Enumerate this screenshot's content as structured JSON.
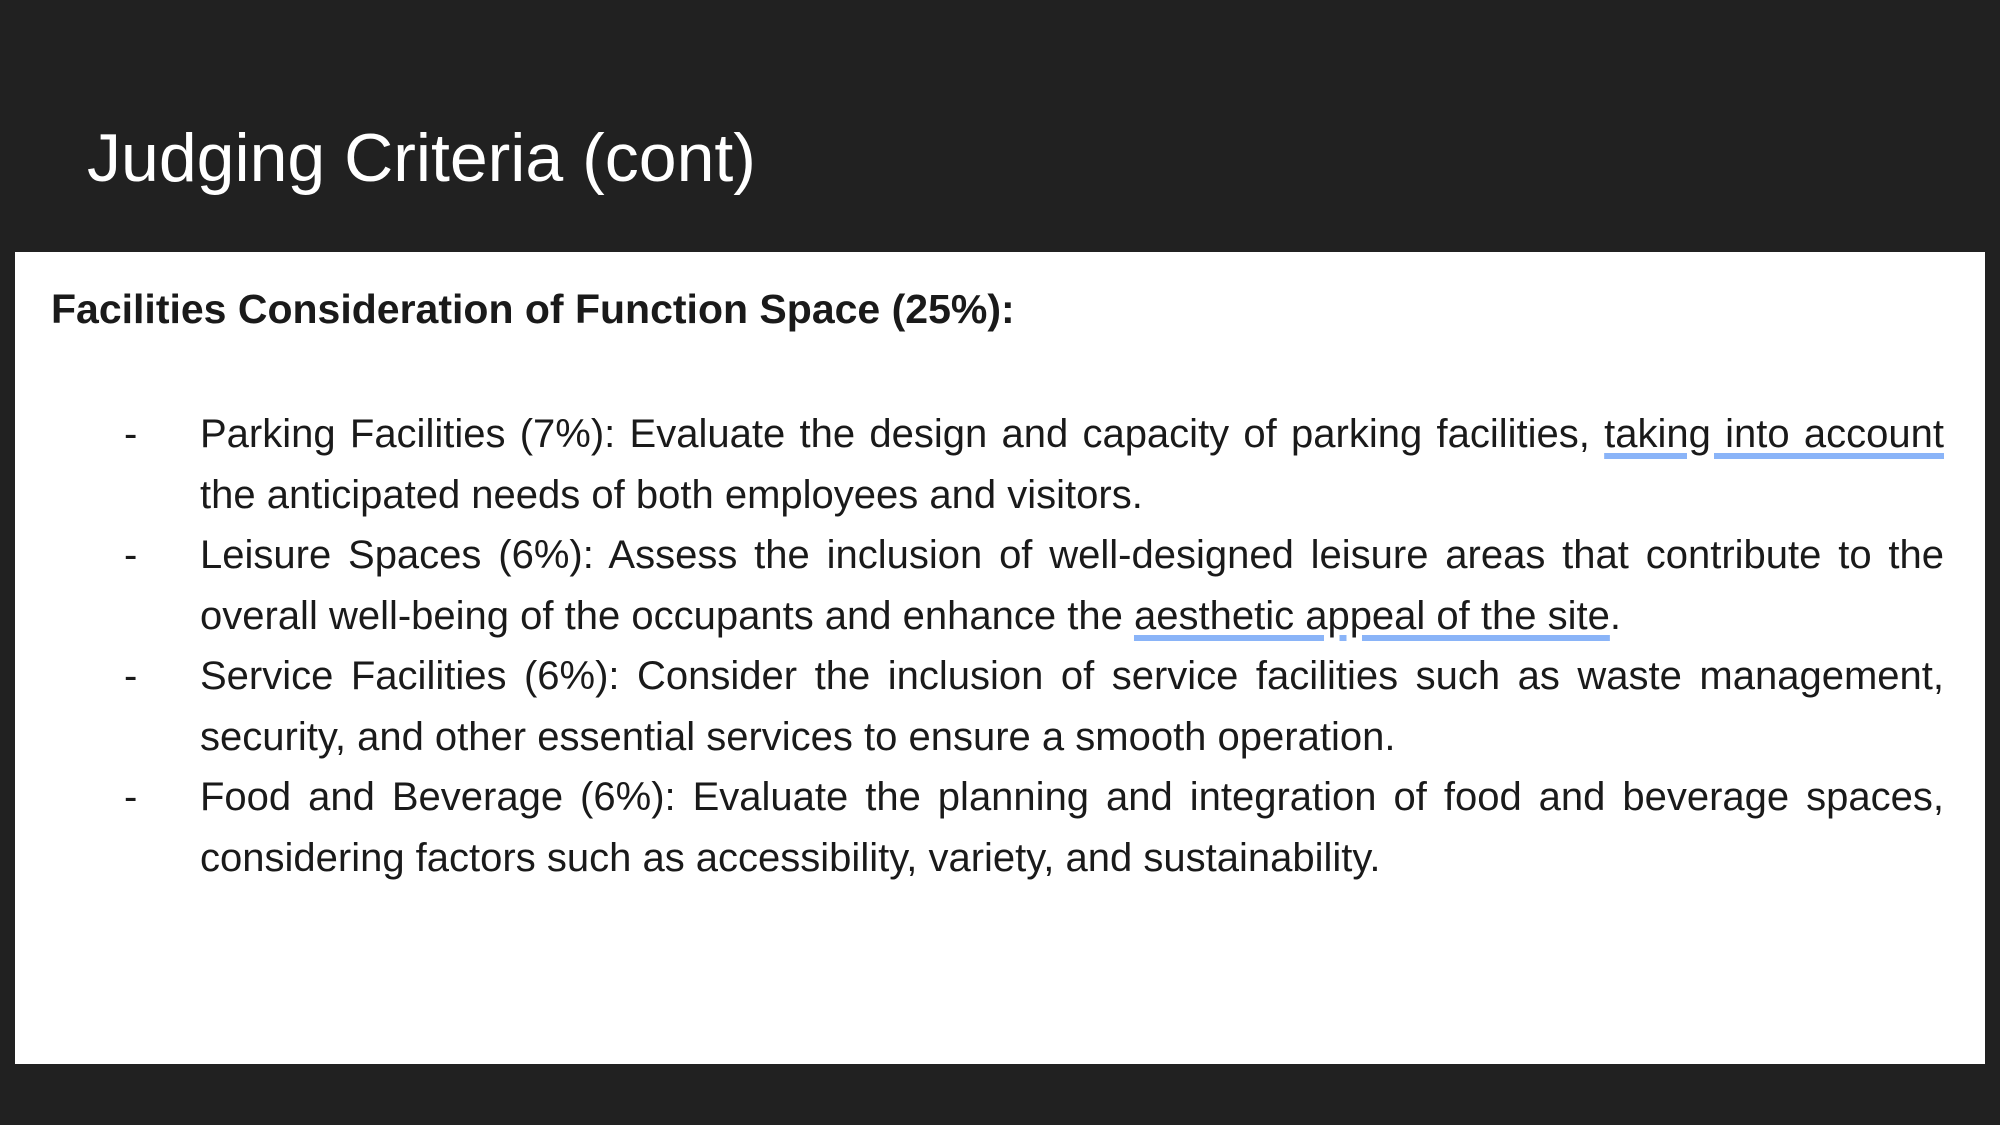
{
  "slide": {
    "title": "Judging Criteria (cont)"
  },
  "section": {
    "heading": "Facilities Consideration of Function Space (25%):",
    "bullet": "-",
    "items": [
      {
        "pre": "Parking Facilities (7%): Evaluate the design and capacity of parking facilities,",
        "link": "taking into account",
        "post": "the anticipated needs of both employees and visitors."
      },
      {
        "pre": "Leisure Spaces (6%): Assess the inclusion of well-designed leisure areas that contribute to the overall well-being of the occupants and enhance the",
        "link": "aesthetic appeal of the site",
        "post": "."
      },
      {
        "pre": "Service Facilities (6%): Consider the inclusion of service facilities such as waste management, security, and other essential services to ensure a smooth operation."
      },
      {
        "pre": "Food and Beverage (6%): Evaluate the planning and integration of food and beverage spaces, considering factors such as accessibility, variety, and sustainability."
      }
    ]
  },
  "colors": {
    "background": "#212121",
    "panel": "#ffffff",
    "text": "#1a1a1a",
    "underline": "#8ab4f8"
  }
}
